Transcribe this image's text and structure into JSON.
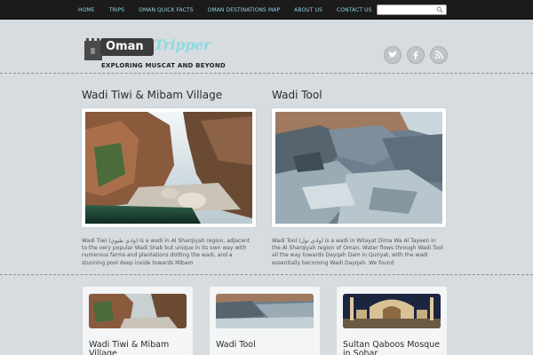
{
  "nav": {
    "items": [
      "HOME",
      "TRIPS",
      "OMAN QUICK FACTS",
      "OMAN DESTINATIONS MAP",
      "ABOUT US",
      "CONTACT US"
    ]
  },
  "search": {
    "placeholder": "",
    "icon": "magnifier-icon"
  },
  "header": {
    "logo_part1": "Oman",
    "logo_part2": "Tripper",
    "tagline": "EXPLORING MUSCAT AND BEYOND",
    "social_icons": [
      "twitter-icon",
      "facebook-icon",
      "rss-icon"
    ]
  },
  "featured": [
    {
      "title": "Wadi Tiwi & Mibam Village",
      "excerpt": "Wadi Tiwi (وادي طيوي) is a wadi in Al Sharqiyah region, adjacent to the very popular Wadi Shab but unique in its own way with numerous farms and plantations dotting the wadi, and a stunning pool deep inside towards Mibam"
    },
    {
      "title": "Wadi Tool",
      "excerpt": "Wadi Tool (وادي تول) is a wadi in Wilayat Dima Wa Al Tayeen in the Al Sharqiyah region of Oman. Water flows through Wadi Tool all the way towards Dayqah Dam in Quriyat, with the wadi essentially becoming Wadi Dayqah. We found"
    }
  ],
  "cards": [
    {
      "title": "Wadi Tiwi & Mibam Village"
    },
    {
      "title": "Wadi Tool"
    },
    {
      "title": "Sultan Qaboos Mosque in Sohar"
    }
  ],
  "colors": {
    "topbar": "#1b1b1b",
    "nav_link": "#8fd3e6",
    "background": "#d6dcdf",
    "logo_accent": "#8fd9e0"
  }
}
